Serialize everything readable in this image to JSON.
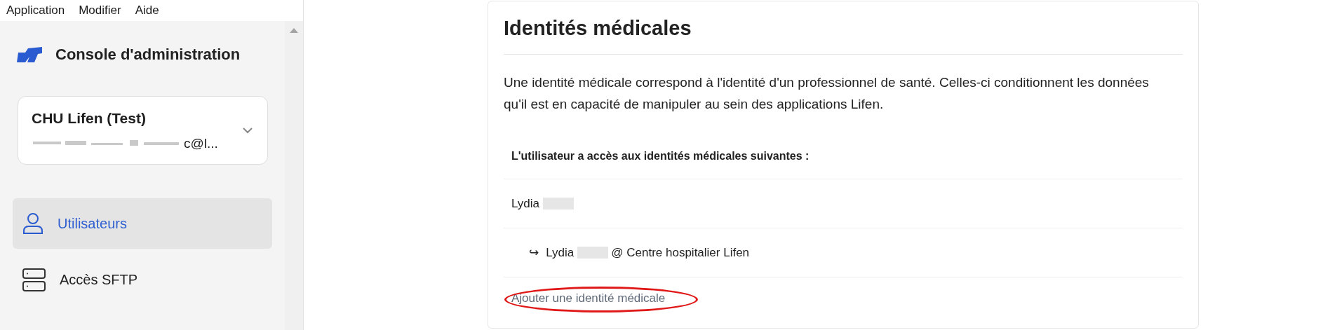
{
  "menu_bar": {
    "items": [
      "Application",
      "Modifier",
      "Aide"
    ]
  },
  "sidebar": {
    "title": "Console d'administration",
    "organization": {
      "name": "CHU Lifen (Test)",
      "email_visible": "c@l..."
    },
    "items": [
      {
        "label": "Utilisateurs",
        "kind": "user",
        "selected": true
      },
      {
        "label": "Accès SFTP",
        "kind": "server",
        "selected": false
      }
    ]
  },
  "card": {
    "title": "Identités médicales",
    "description": "Une identité médicale correspond à l'identité d'un professionnel de santé. Celles-ci conditionnent les données qu'il est en capacité de manipuler au sein des applications Lifen.",
    "list_heading": "L'utilisateur a accès aux identités médicales suivantes :",
    "identities": [
      {
        "name": "Lydia",
        "redacted": true,
        "children": [
          {
            "arrow": "↪",
            "name": "Lydia",
            "redacted": true,
            "place": "@ Centre hospitalier Lifen"
          }
        ]
      }
    ],
    "add_link": {
      "label": "Ajouter une identité médicale",
      "highlighted": true
    }
  }
}
